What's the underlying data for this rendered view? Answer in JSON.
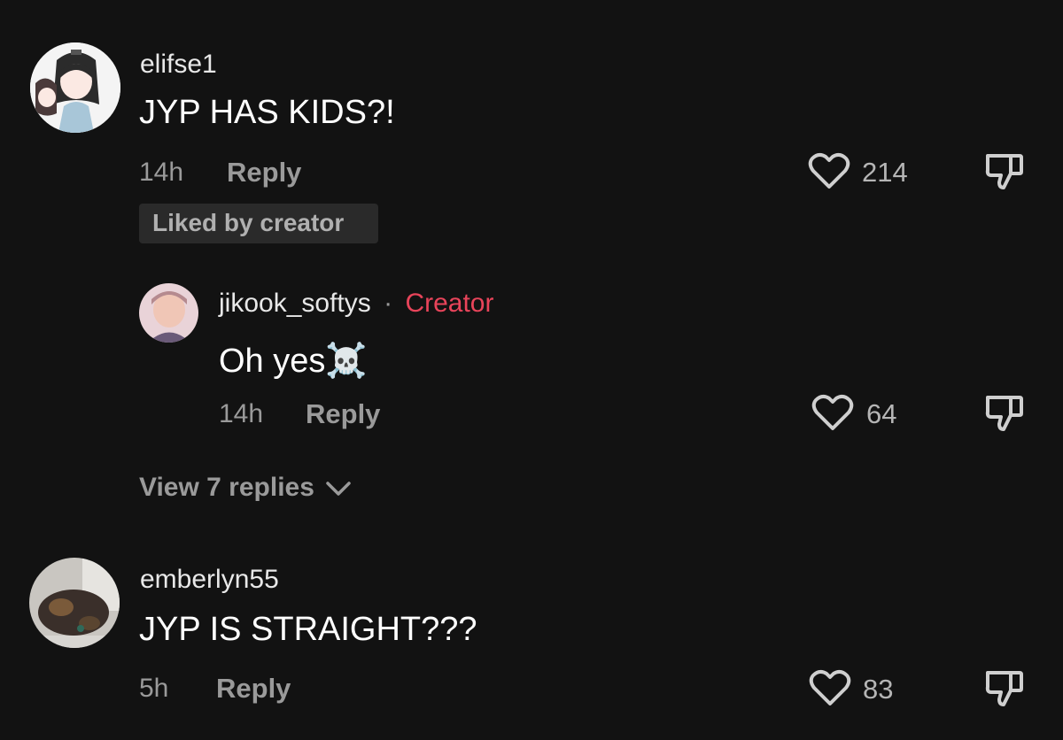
{
  "comments": [
    {
      "username": "elifse1",
      "text": "JYP HAS KIDS?!",
      "time": "14h",
      "reply_label": "Reply",
      "likes": "214",
      "badge": "Liked by creator"
    },
    {
      "username": "jikook_softys",
      "separator": "·",
      "creator_label": "Creator",
      "text": "Oh yes",
      "emoji": "☠️",
      "time": "14h",
      "reply_label": "Reply",
      "likes": "64"
    },
    {
      "username": "emberlyn55",
      "text": "JYP IS STRAIGHT???",
      "time": "5h",
      "reply_label": "Reply",
      "likes": "83"
    }
  ],
  "view_replies": "View 7 replies",
  "icons": {
    "like": "heart-outline-icon",
    "dislike": "thumbs-down-icon",
    "expand": "chevron-down-icon"
  },
  "colors": {
    "background": "#121212",
    "creator_accent": "#e8445a",
    "secondary_text": "#9a9a9a"
  }
}
